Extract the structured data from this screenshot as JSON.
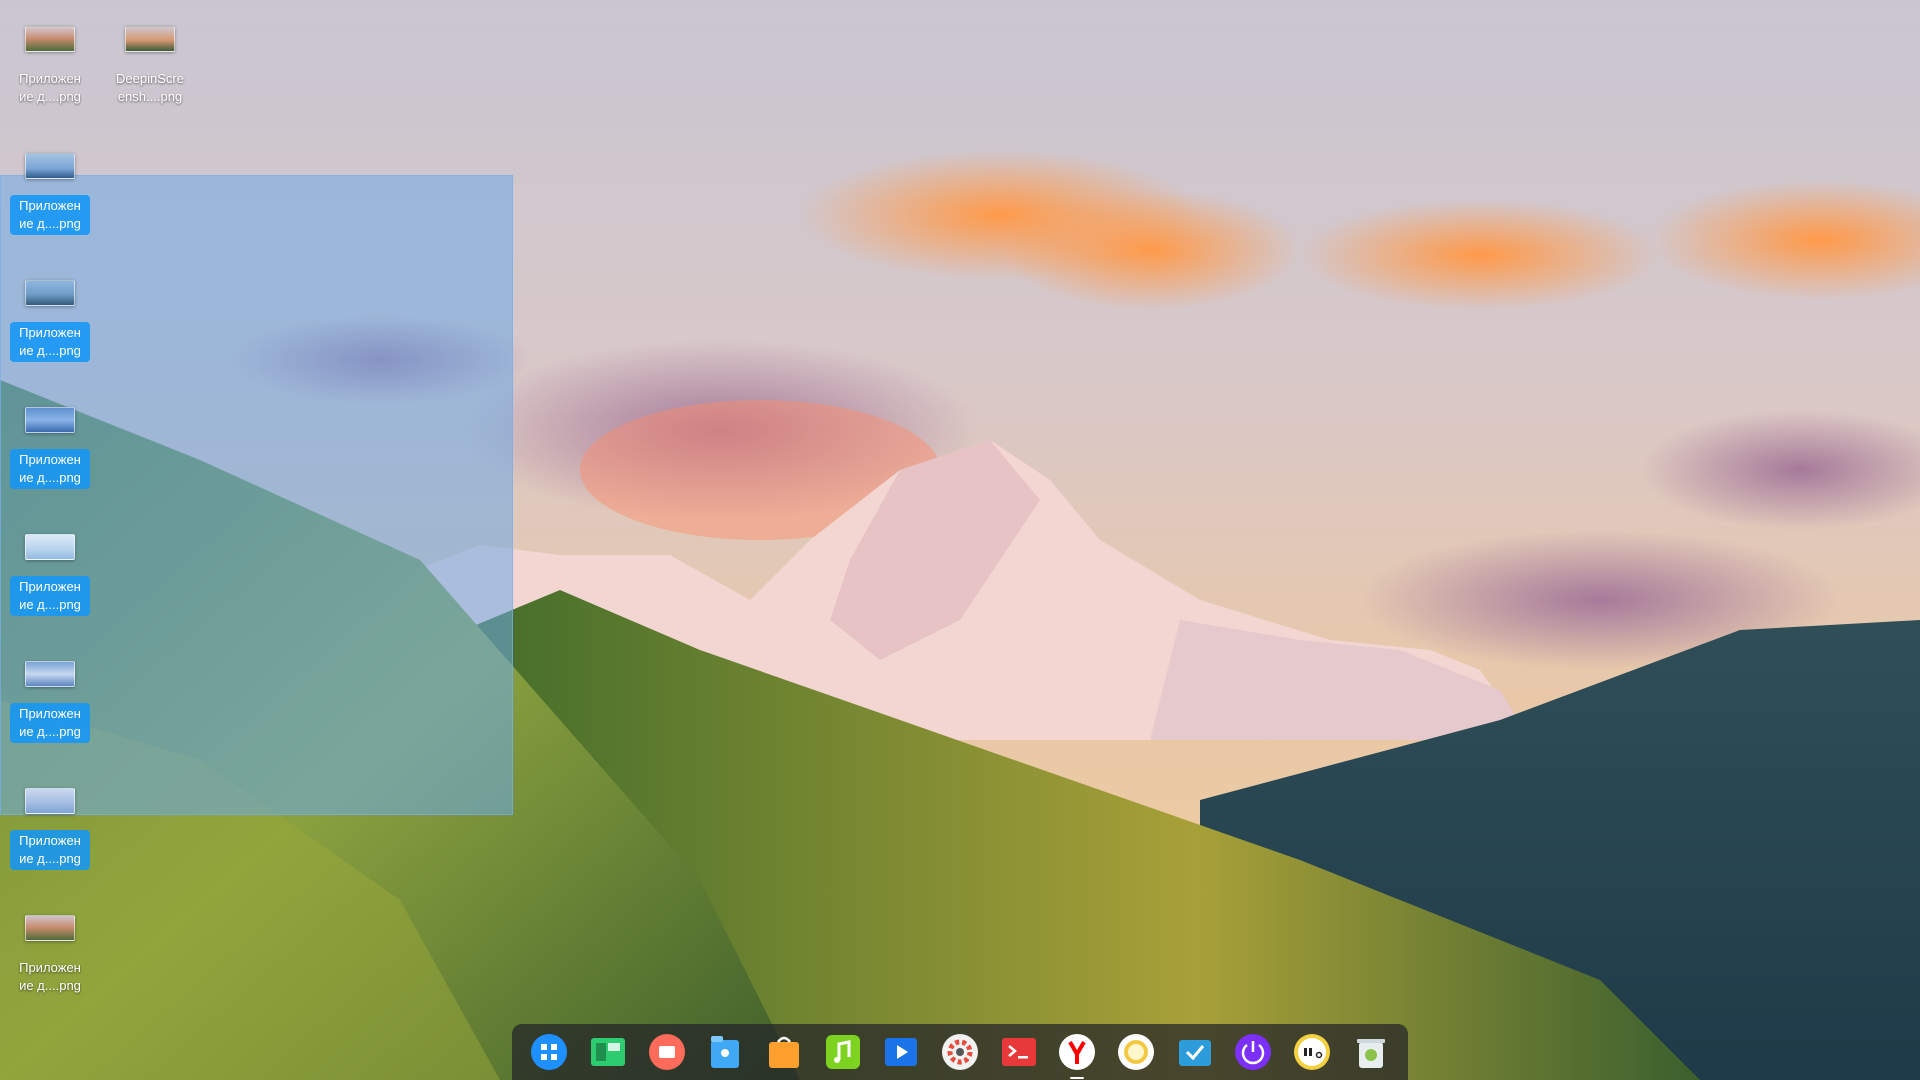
{
  "desktop": {
    "icons": [
      {
        "label": "Приложен ие д....png",
        "selected": false
      },
      {
        "label": "DeepinScre ensh....png",
        "selected": false
      },
      {
        "label": "Приложен ие д....png",
        "selected": true
      },
      {
        "label": "Приложен ие д....png",
        "selected": true
      },
      {
        "label": "Приложен ие д....png",
        "selected": true
      },
      {
        "label": "Приложен ие д....png",
        "selected": true
      },
      {
        "label": "Приложен ие д....png",
        "selected": true
      },
      {
        "label": "Приложен ие д....png",
        "selected": true
      },
      {
        "label": "Приложен ие д....png",
        "selected": false
      }
    ]
  },
  "dock": {
    "apps": [
      {
        "icon": "launcher-icon",
        "color": "#1e90ff"
      },
      {
        "icon": "multitasking-view-icon",
        "color": "#2ecc71"
      },
      {
        "icon": "screen-recorder-icon",
        "color": "#ff6b5b"
      },
      {
        "icon": "file-manager-icon",
        "color": "#3fa9f5"
      },
      {
        "icon": "app-store-icon",
        "color": "#ff9f2e"
      },
      {
        "icon": "music-player-icon",
        "color": "#7ed321"
      },
      {
        "icon": "movie-player-icon",
        "color": "#1a73e8"
      },
      {
        "icon": "control-center-icon",
        "color": "#e74c3c"
      },
      {
        "icon": "terminal-icon",
        "color": "#e8393a"
      },
      {
        "icon": "yandex-browser-icon",
        "color": "#ff0000"
      },
      {
        "icon": "photo-viewer-icon",
        "color": "#f5c842"
      },
      {
        "icon": "screenshot-tool-icon",
        "color": "#2d9cdb"
      },
      {
        "icon": "shutdown-icon",
        "color": "#7b2ff7"
      },
      {
        "icon": "clock-icon",
        "color": "#f5d142"
      },
      {
        "icon": "trash-icon",
        "color": "#8bc34a"
      }
    ]
  }
}
